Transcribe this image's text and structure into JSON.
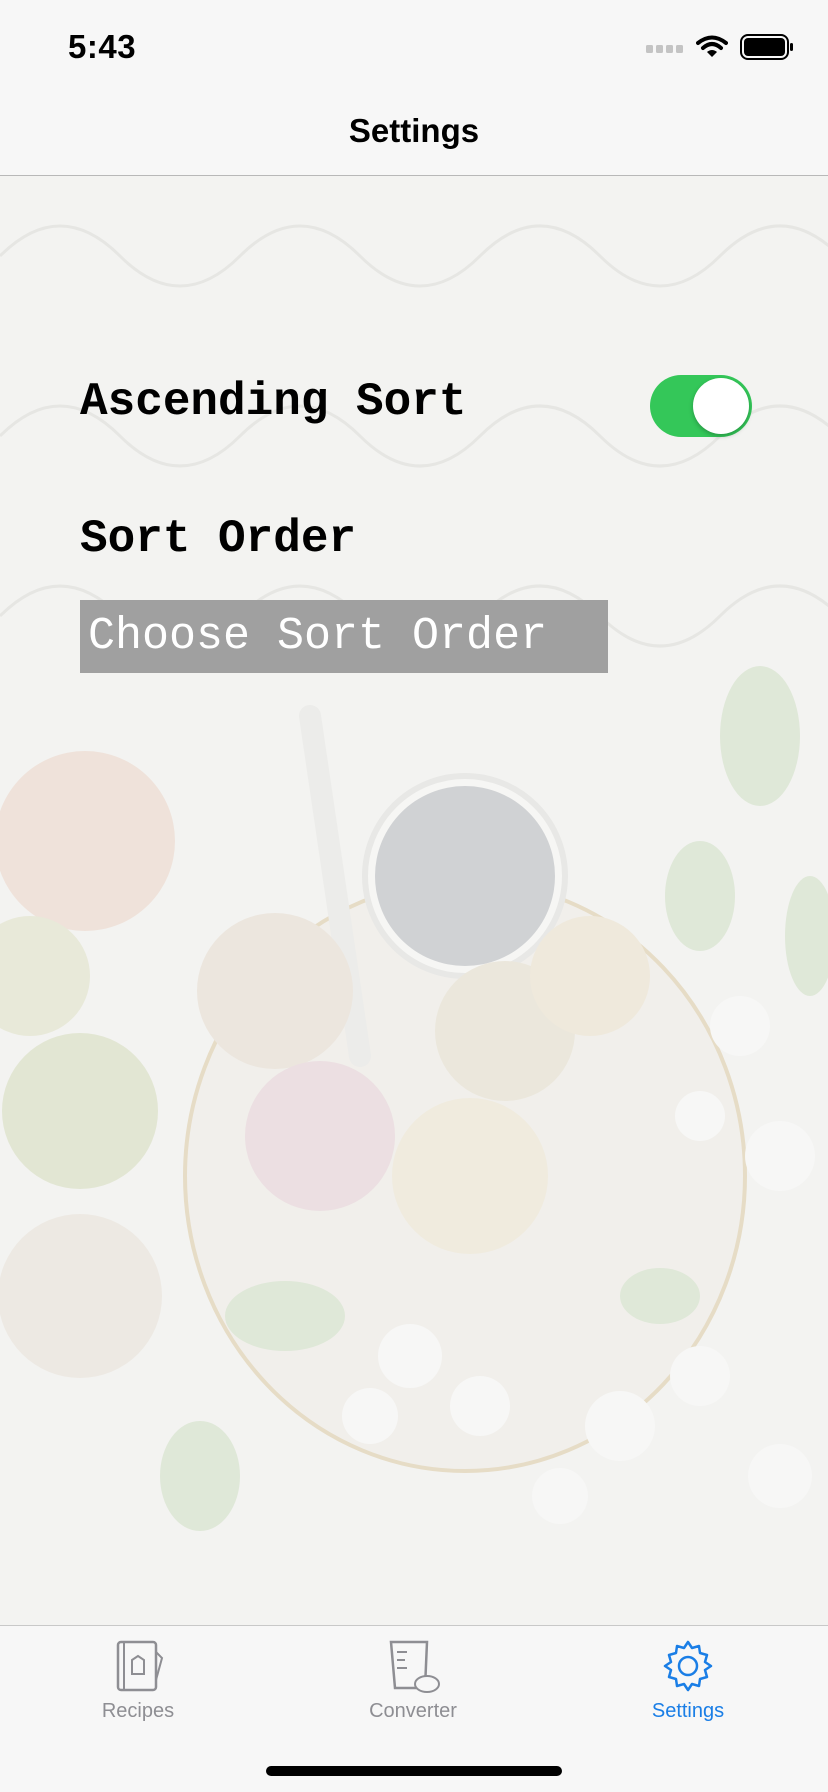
{
  "status_bar": {
    "time": "5:43",
    "signal_icon": "cellular-signal-icon",
    "wifi_icon": "wifi-icon",
    "battery_icon": "battery-icon"
  },
  "nav": {
    "title": "Settings"
  },
  "settings": {
    "ascending_sort_label": "Ascending Sort",
    "ascending_sort_enabled": true,
    "sort_order_label": "Sort Order",
    "sort_order_button": "Choose Sort Order"
  },
  "tabs": [
    {
      "label": "Recipes",
      "icon": "recipe-book-icon",
      "active": false
    },
    {
      "label": "Converter",
      "icon": "measuring-cup-icon",
      "active": false
    },
    {
      "label": "Settings",
      "icon": "gear-icon",
      "active": true
    }
  ],
  "colors": {
    "toggle_on": "#34c759",
    "tab_active": "#1a7ee6",
    "tab_inactive": "#8e8e93",
    "button_bg": "#a0a0a0"
  }
}
